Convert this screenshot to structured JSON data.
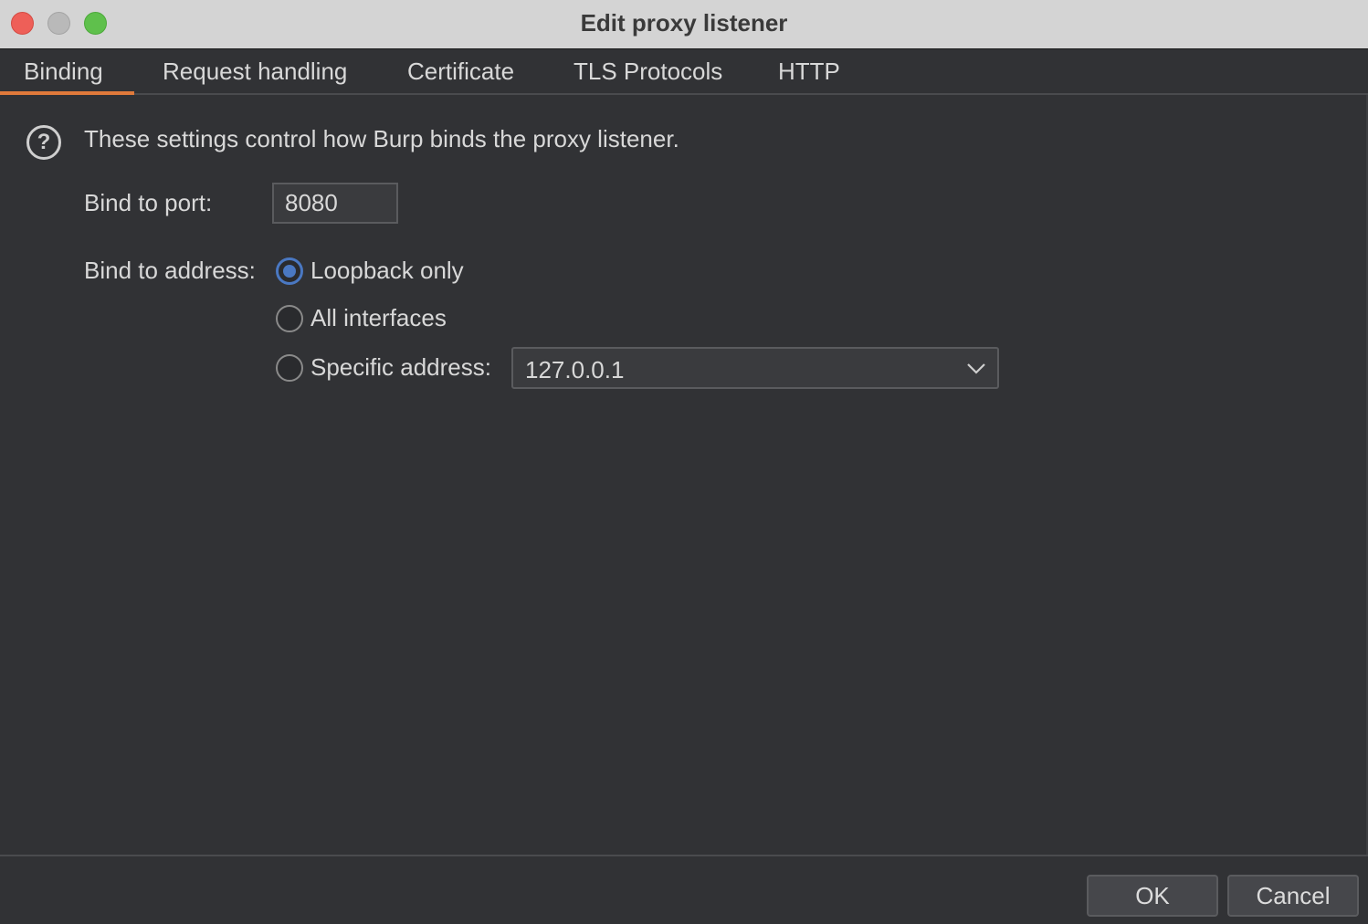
{
  "window": {
    "title": "Edit proxy listener"
  },
  "tabs": [
    {
      "label": "Binding",
      "active": true
    },
    {
      "label": "Request handling",
      "active": false
    },
    {
      "label": "Certificate",
      "active": false
    },
    {
      "label": "TLS Protocols",
      "active": false
    },
    {
      "label": "HTTP",
      "active": false
    }
  ],
  "binding": {
    "help_icon": "question-circle-icon",
    "description": "These settings control how Burp binds the proxy listener.",
    "port_label": "Bind to port:",
    "port_value": "8080",
    "address_label": "Bind to address:",
    "options": [
      {
        "label": "Loopback only",
        "selected": true
      },
      {
        "label": "All interfaces",
        "selected": false
      },
      {
        "label": "Specific address:",
        "selected": false
      }
    ],
    "specific_address_value": "127.0.0.1"
  },
  "buttons": {
    "ok": "OK",
    "cancel": "Cancel"
  },
  "colors": {
    "accent_tab": "#e07a3b",
    "radio_selected": "#4a78c2",
    "background": "#313235"
  }
}
